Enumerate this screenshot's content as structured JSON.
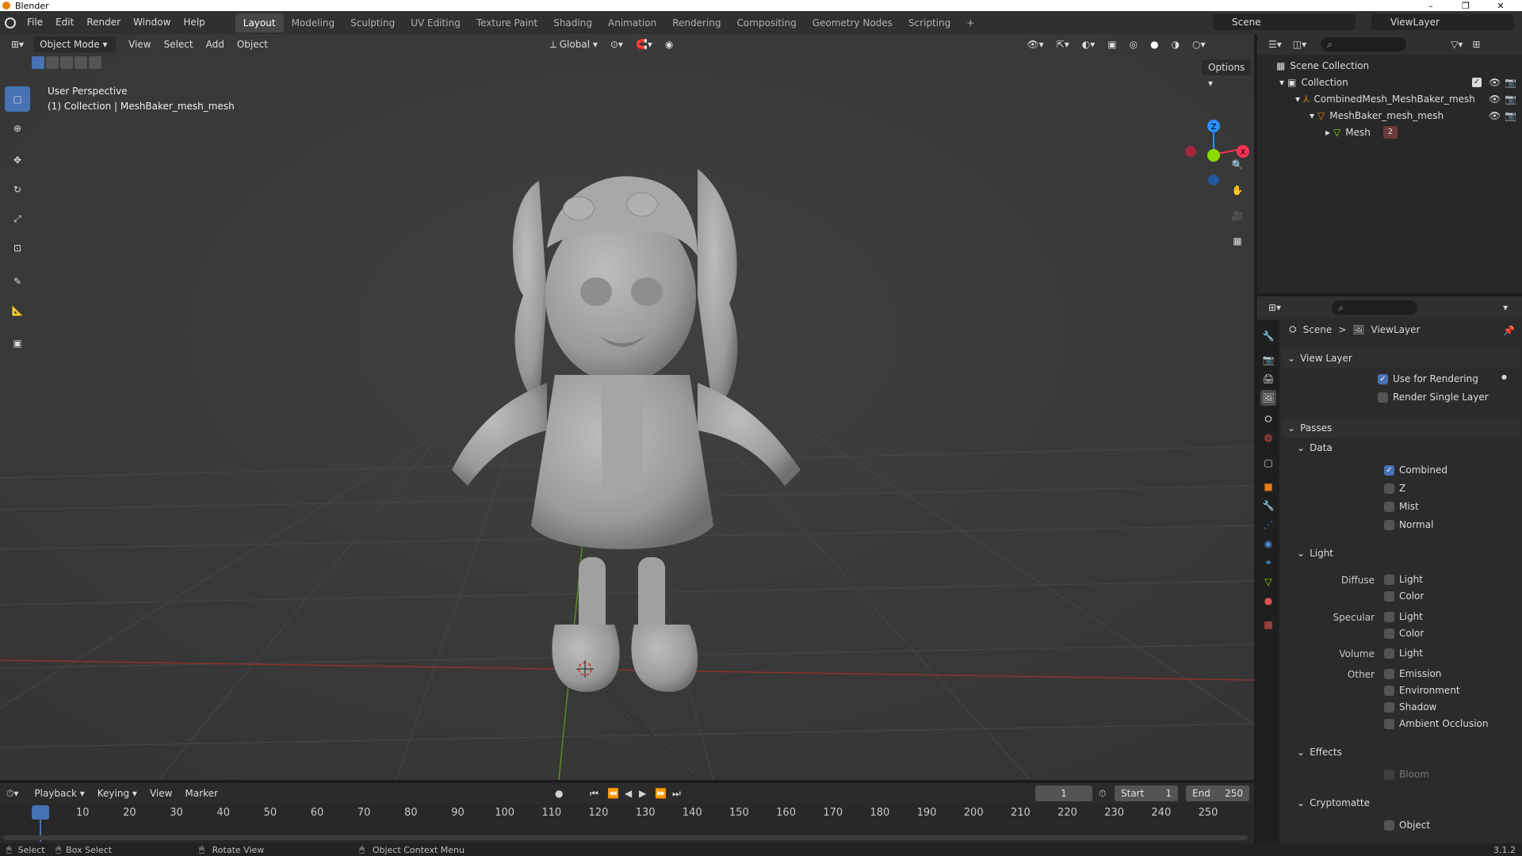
{
  "window": {
    "title": "Blender",
    "minimize": "–",
    "maximize": "❐",
    "close": "✕"
  },
  "menu": [
    "File",
    "Edit",
    "Render",
    "Window",
    "Help"
  ],
  "workspaces": [
    "Layout",
    "Modeling",
    "Sculpting",
    "UV Editing",
    "Texture Paint",
    "Shading",
    "Animation",
    "Rendering",
    "Compositing",
    "Geometry Nodes",
    "Scripting"
  ],
  "workspace_add": "+",
  "scene_field": "Scene",
  "viewlayer_field": "ViewLayer",
  "viewport": {
    "mode": "Object Mode",
    "menus": [
      "View",
      "Select",
      "Add",
      "Object"
    ],
    "orientation": "Global",
    "options": "Options",
    "overlay_title": "User Perspective",
    "overlay_sub": "(1) Collection | MeshBaker_mesh_mesh",
    "axes": {
      "z": "Z",
      "x": "X",
      "y": "Y"
    }
  },
  "outliner": {
    "scene_collection": "Scene Collection",
    "collection": "Collection",
    "combined": "CombinedMesh_MeshBaker_mesh",
    "meshbaker": "MeshBaker_mesh_mesh",
    "mesh": "Mesh",
    "mesh_badge": "2"
  },
  "properties": {
    "breadcrumb_scene": "Scene",
    "breadcrumb_sep": ">",
    "breadcrumb_viewlayer": "ViewLayer",
    "view_layer": "View Layer",
    "use_for_rendering": "Use for Rendering",
    "render_single_layer": "Render Single Layer",
    "passes": "Passes",
    "data": "Data",
    "data_items": [
      {
        "label": "Combined",
        "checked": true
      },
      {
        "label": "Z",
        "checked": false
      },
      {
        "label": "Mist",
        "checked": false
      },
      {
        "label": "Normal",
        "checked": false
      }
    ],
    "light": "Light",
    "diffuse": "Diffuse",
    "specular": "Specular",
    "volume": "Volume",
    "other": "Other",
    "light_label": "Light",
    "color_label": "Color",
    "emission": "Emission",
    "environment": "Environment",
    "shadow": "Shadow",
    "ambient_occlusion": "Ambient Occlusion",
    "effects": "Effects",
    "bloom": "Bloom",
    "cryptomatte": "Cryptomatte",
    "object": "Object"
  },
  "timeline": {
    "menus": [
      "Playback",
      "Keying",
      "View",
      "Marker"
    ],
    "current_frame": "1",
    "start_label": "Start",
    "start": "1",
    "end_label": "End",
    "end": "250",
    "ticks": [
      "1",
      "10",
      "20",
      "30",
      "40",
      "50",
      "60",
      "70",
      "80",
      "90",
      "100",
      "110",
      "120",
      "130",
      "140",
      "150",
      "160",
      "170",
      "180",
      "190",
      "200",
      "210",
      "220",
      "230",
      "240",
      "250"
    ]
  },
  "status": {
    "select": "Select",
    "box_select": "Box Select",
    "rotate_view": "Rotate View",
    "context_menu": "Object Context Menu",
    "version": "3.1.2"
  },
  "colors": {
    "accent": "#4772b3",
    "x_axis": "#ff3352",
    "y_axis": "#8bdc00",
    "z_axis": "#2890ff",
    "orange": "#e87d0d"
  }
}
